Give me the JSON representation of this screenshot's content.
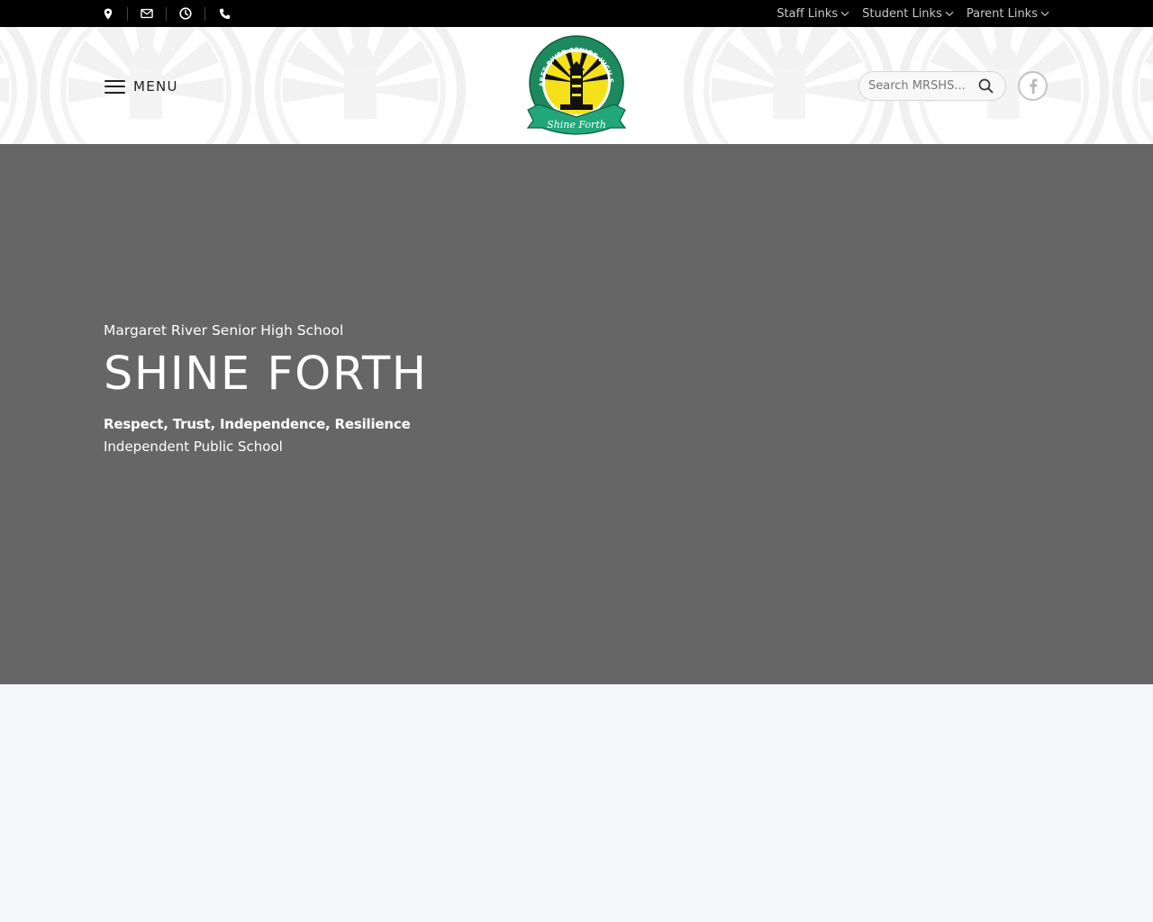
{
  "topbar": {
    "icons": [
      "location-pin-icon",
      "envelope-icon",
      "clock-icon",
      "phone-icon"
    ],
    "links": [
      {
        "label": "Staff Links",
        "icon": "chevron-down-icon"
      },
      {
        "label": "Student Links",
        "icon": "chevron-down-icon"
      },
      {
        "label": "Parent Links",
        "icon": "chevron-down-icon"
      }
    ]
  },
  "header": {
    "menu_label": "MENU",
    "menu_icon": "hamburger-icon",
    "logo": {
      "ring_text": "MARGARET RIVER SENIOR HIGH SCHOOL",
      "motto": "Shine Forth",
      "colors": {
        "ring": "#1c8a5e",
        "ribbon": "#22a77a",
        "sun": "#f5e11a",
        "tower": "#111111"
      }
    },
    "search": {
      "placeholder": "Search MRSHS...",
      "icon": "search-icon"
    },
    "social": {
      "icon": "facebook-icon"
    }
  },
  "hero": {
    "kicker": "Margaret River Senior High School",
    "title": "SHINE FORTH",
    "values": "Respect, Trust, Independence, Resilience",
    "school_type": "Independent Public School",
    "background_color": "#666666"
  },
  "colors": {
    "topbar_bg": "#000000",
    "header_bg": "#ffffff",
    "page_bg": "#f4f6fa",
    "topbar_text": "#c9c9c9"
  }
}
